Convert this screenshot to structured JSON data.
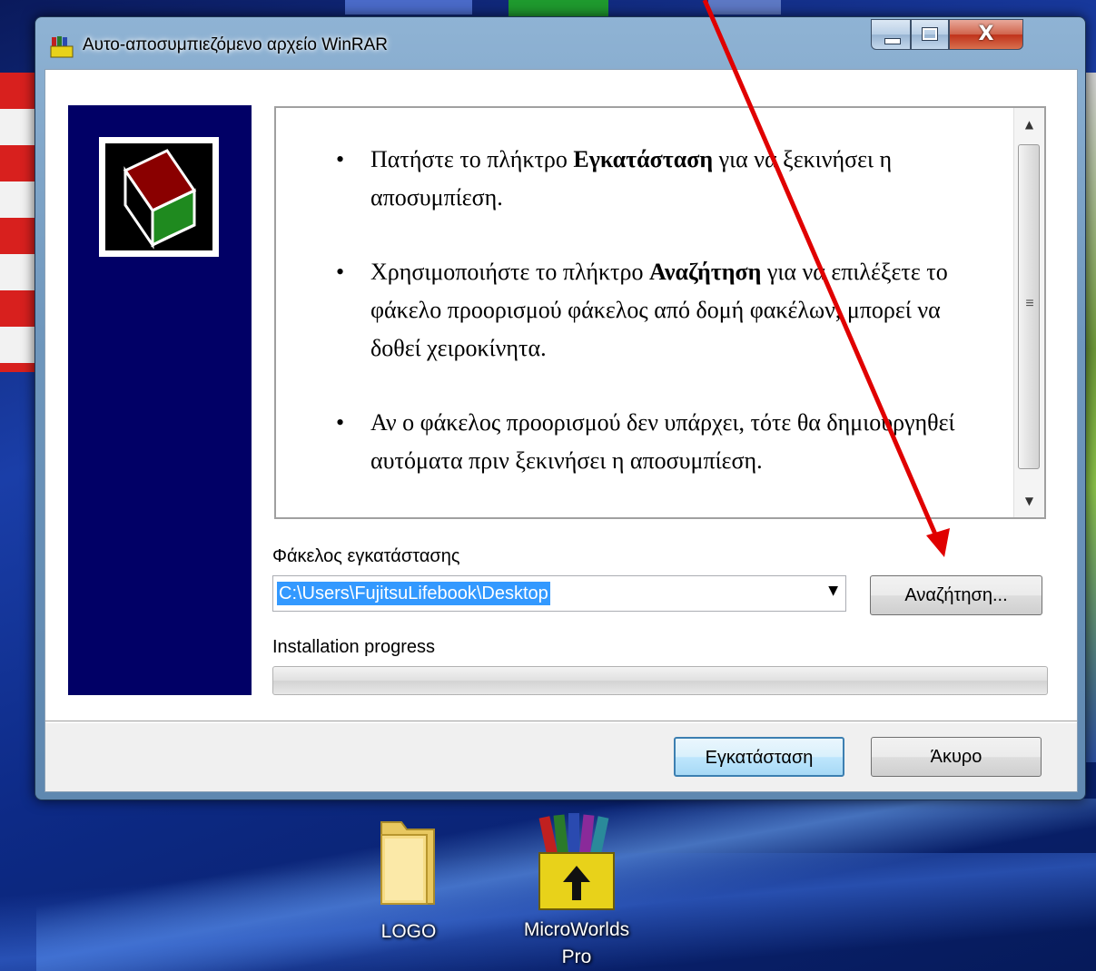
{
  "window": {
    "title": "Αυτο-αποσυμπιεζόμενο αρχείο WinRAR",
    "controls": {
      "close_glyph": "X"
    }
  },
  "instructions": [
    {
      "bullet": "•",
      "before": "Πατήστε το πλήκτρο ",
      "bold": "Εγκατάσταση",
      "after": " για να ξεκινήσει η αποσυμπίεση."
    },
    {
      "bullet": "•",
      "before": "Χρησιμοποιήστε το πλήκτρο ",
      "bold": "Αναζήτηση",
      "after": " για να επιλέξετε το φάκελο προορισμού φάκελος από δομή φακέλων, μπορεί να δοθεί χειροκίνητα."
    },
    {
      "bullet": "•",
      "before": "Αν ο φάκελος προορισμού δεν υπάρχει, τότε θα δημιουργηθεί αυτόματα πριν ξεκινήσει η αποσυμπίεση.",
      "bold": "",
      "after": ""
    }
  ],
  "destination": {
    "label": "Φάκελος εγκατάστασης",
    "value": "C:\\Users\\FujitsuLifebook\\Desktop",
    "browse_label": "Αναζήτηση..."
  },
  "progress": {
    "label": "Installation progress",
    "value": 0
  },
  "buttons": {
    "install_label": "Εγκατάσταση",
    "cancel_label": "Άκυρο"
  },
  "desktop_icons": [
    {
      "label": "LOGO",
      "icon": "folder-icon"
    },
    {
      "label": "MicroWorlds Pro",
      "icon": "winrar-archive-icon"
    }
  ],
  "colors": {
    "side_panel": "#010066",
    "selection": "#3399ff",
    "annotation_arrow": "#e00000"
  }
}
